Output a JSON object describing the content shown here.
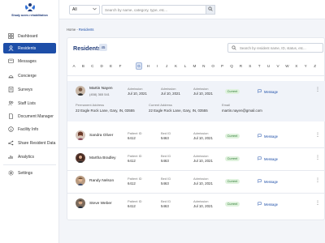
{
  "app": {
    "logo_text": "Shady acres rehabilitation"
  },
  "sidebar": {
    "items": [
      {
        "label": "Dashboard",
        "icon": "dashboard-icon"
      },
      {
        "label": "Residents",
        "icon": "residents-icon",
        "active": true
      },
      {
        "label": "Messages",
        "icon": "messages-icon"
      },
      {
        "label": "Concierge",
        "icon": "concierge-icon"
      },
      {
        "label": "Surveys",
        "icon": "surveys-icon"
      },
      {
        "label": "Staff Lists",
        "icon": "staff-icon"
      },
      {
        "label": "Document Manager",
        "icon": "document-icon"
      },
      {
        "label": "Facility Info",
        "icon": "info-icon"
      },
      {
        "label": "Share Resident Data",
        "icon": "share-icon"
      },
      {
        "label": "Analytics",
        "icon": "analytics-icon"
      },
      {
        "label": "Settings",
        "icon": "gear-icon"
      }
    ]
  },
  "topbar": {
    "filter_value": "All",
    "search_placeholder": "Search by name, category, type, etc..."
  },
  "breadcrumb": {
    "home": "Home",
    "sep": " - ",
    "current": "Residents"
  },
  "residents": {
    "title": "Residents",
    "count": "45",
    "search_placeholder": "Search by resident name, ID, status, etc...",
    "letters": [
      "A",
      "B",
      "C",
      "D",
      "E",
      "F",
      "G",
      "H",
      "I",
      "J",
      "K",
      "L",
      "M",
      "N",
      "O",
      "P",
      "Q",
      "R",
      "S",
      "T",
      "U",
      "V",
      "W",
      "X",
      "Y",
      "Z"
    ],
    "active_letter": "G",
    "expanded": {
      "name": "Martin Nayen",
      "phone": "(458) 365 541",
      "admission_label": "Admission",
      "admission_date": "Jul 10, 2021",
      "status": "Current",
      "message_label": "Message",
      "permanent_label": "Permanent Address",
      "permanent_value": "22 Eagle Rock Lane, Gary, IN, 03555",
      "current_label": "Current Address",
      "current_value": "22 Eagle Rock Lane, Gary, IN, 03555",
      "email_label": "Email",
      "email_value": "martin.nayen@gmail.com"
    },
    "list": [
      {
        "name": "Sandra Oliver",
        "patient_label": "Patient ID",
        "patient_id": "6412",
        "bed_label": "Bed ID",
        "bed_id": "5463",
        "admission_label": "Admission",
        "admission_date": "Jul 10, 2021",
        "status": "Current",
        "message_label": "Message"
      },
      {
        "name": "Martha Bradley",
        "patient_label": "Patient ID",
        "patient_id": "6412",
        "bed_label": "Bed ID",
        "bed_id": "5463",
        "admission_label": "Admission",
        "admission_date": "Jul 10, 2021",
        "status": "Current",
        "message_label": "Message"
      },
      {
        "name": "Randy Nelson",
        "patient_label": "Patient ID",
        "patient_id": "6412",
        "bed_label": "Bed ID",
        "bed_id": "5463",
        "admission_label": "Admission",
        "admission_date": "Jul 10, 2021",
        "status": "Current",
        "message_label": "Message"
      },
      {
        "name": "Steve Weber",
        "patient_label": "Patient ID",
        "patient_id": "6412",
        "bed_label": "Bed ID",
        "bed_id": "5463",
        "admission_label": "Admission",
        "admission_date": "Jul 10, 2021",
        "status": "Current",
        "message_label": "Message"
      }
    ]
  },
  "colors": {
    "primary": "#1d4ea8",
    "current_badge_bg": "#dff2dd",
    "current_badge_text": "#2e7a34"
  }
}
